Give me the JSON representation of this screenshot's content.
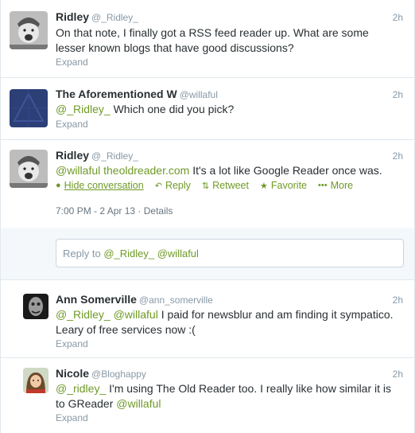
{
  "tweets": [
    {
      "name": "Ridley",
      "handle": "@_Ridley_",
      "time": "2h",
      "line1": "On that note, I finally got a RSS feed reader up. What are some",
      "line2": "lesser known blogs that have good discussions?",
      "expand": "Expand"
    },
    {
      "name": "The Aforementioned W",
      "handle": "@willaful",
      "time": "2h",
      "mention": "@_Ridley_",
      "text": " Which one did you pick?",
      "expand": "Expand"
    },
    {
      "name": "Ridley",
      "handle": "@_Ridley_",
      "time": "2h",
      "mention": "@willaful",
      "link": "theoldreader.com",
      "text": " It's a lot like Google Reader once was.",
      "actions": {
        "hide": "Hide conversation",
        "reply": "Reply",
        "retweet": "Retweet",
        "favorite": "Favorite",
        "more": "More"
      },
      "timestamp": "7:00 PM - 2 Apr 13",
      "separator": " · ",
      "details": "Details"
    }
  ],
  "reply_box": {
    "prefix": "Reply to ",
    "mention1": "@_Ridley_",
    "mention2": "@willaful"
  },
  "replies": [
    {
      "name": "Ann Somerville",
      "handle": "@ann_somerville",
      "time": "2h",
      "mention1": "@_Ridley_",
      "mention2": "@willaful",
      "text1": " I paid for newsblur and am finding it sympatico.",
      "line2": "Leary of free services now :(",
      "expand": "Expand"
    },
    {
      "name": "Nicole",
      "handle": "@Bloghappy",
      "time": "2h",
      "mention": "@_ridley_",
      "text1": " I'm using The Old Reader too. I really like how similar it is",
      "line2a": "to GReader ",
      "mention2": "@willaful",
      "expand": "Expand"
    }
  ],
  "icons": {
    "hide": "speech-bubble-icon",
    "reply": "reply-arrow-icon",
    "retweet": "retweet-icon",
    "favorite": "star-icon",
    "more": "ellipsis-icon"
  },
  "colors": {
    "link": "#6f9a26",
    "muted": "#8899a6",
    "text": "#292f33",
    "border": "#e1e8ed",
    "gray_bg": "#f5f8fa"
  }
}
